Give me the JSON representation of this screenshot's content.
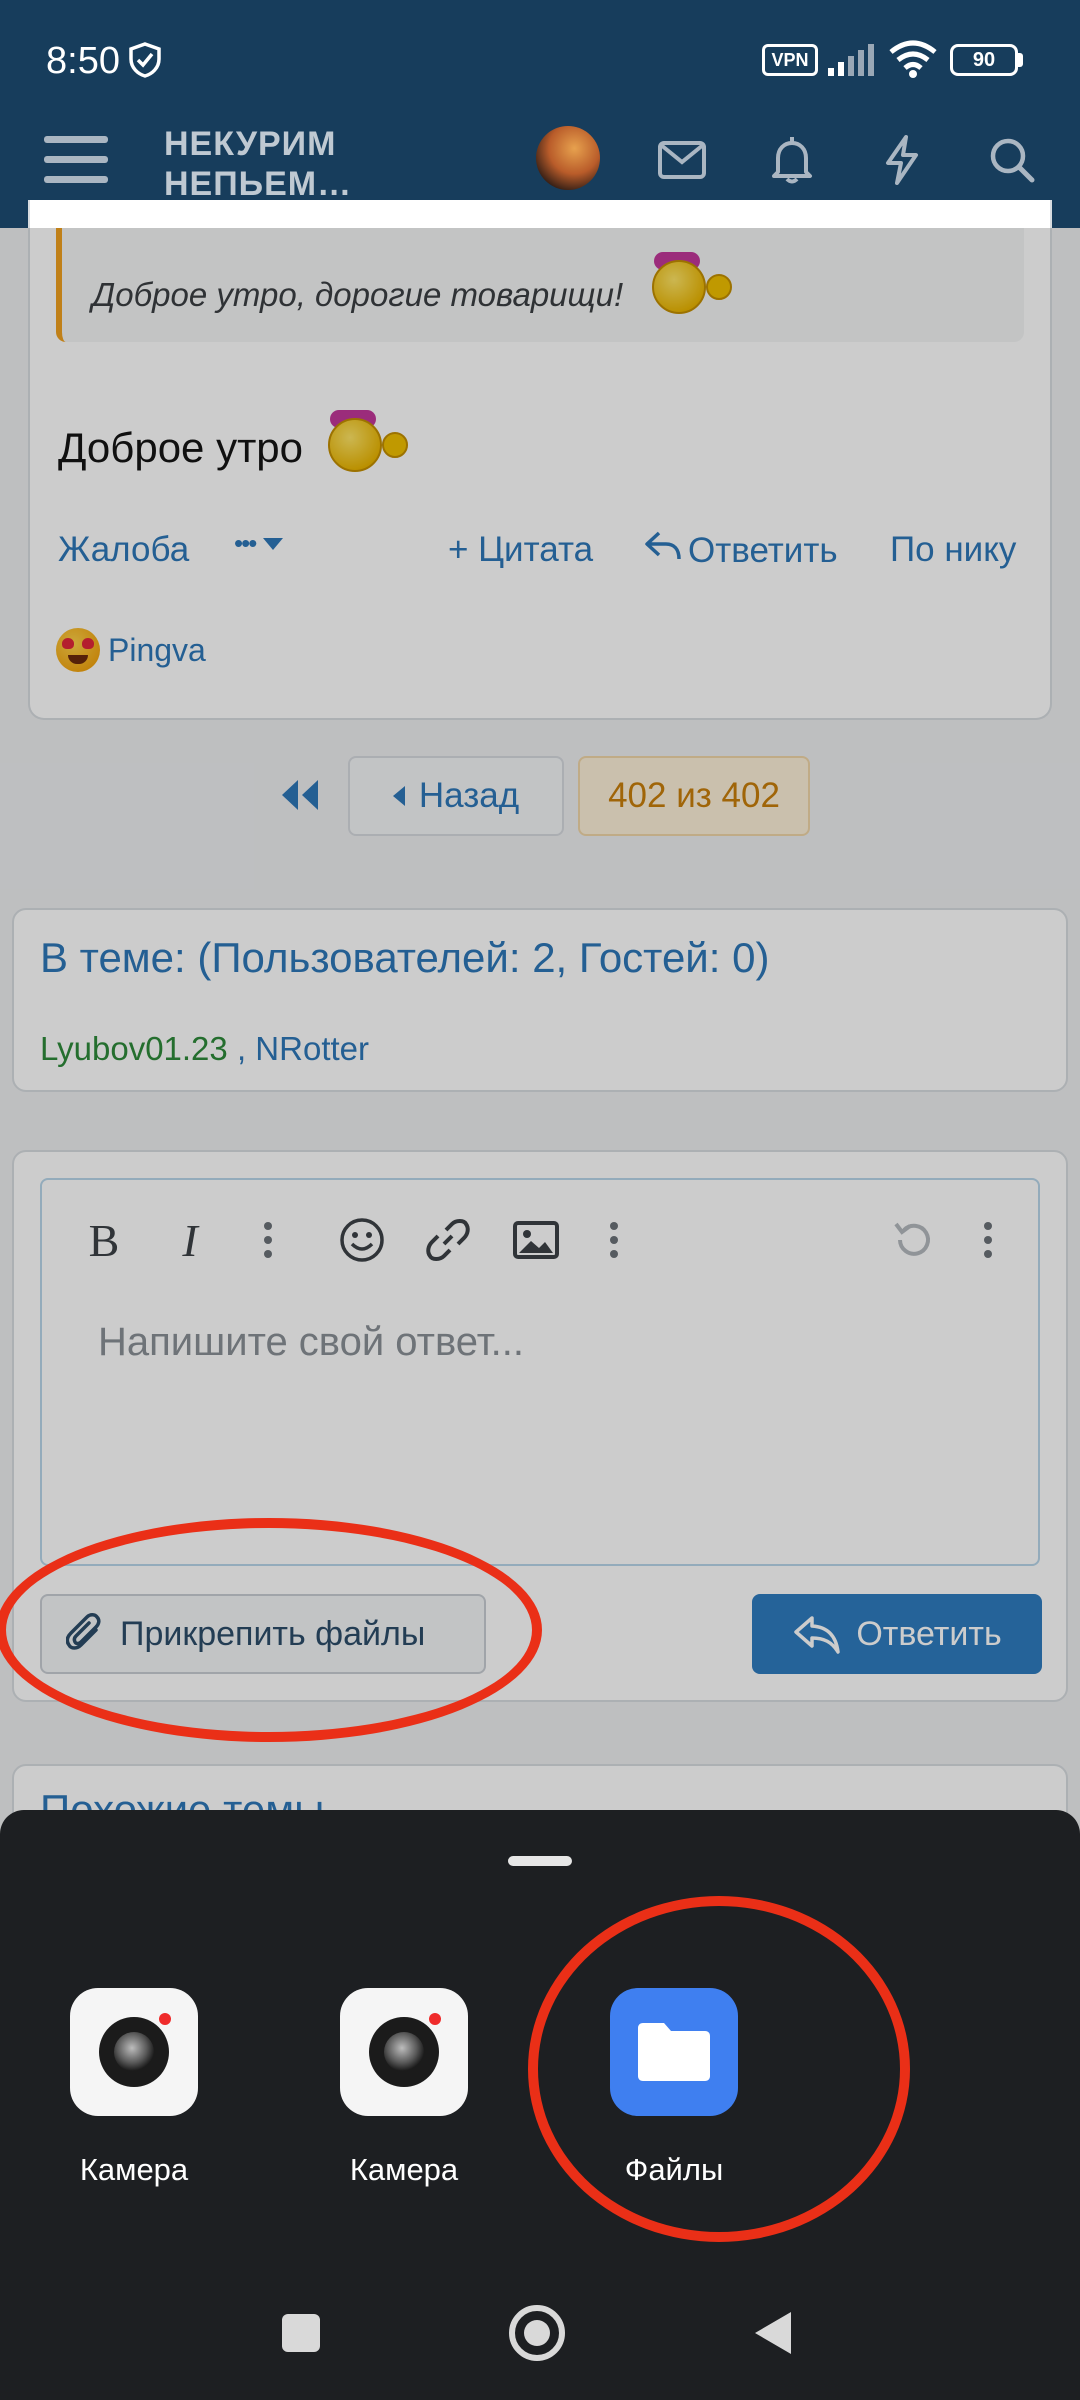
{
  "status_bar": {
    "time": "8:50",
    "vpn": "VPN",
    "battery": "90"
  },
  "header": {
    "logo_line1": "НЕКУРИМ",
    "logo_line2": "НЕПЬЕМ…"
  },
  "post": {
    "quote_text": "Доброе утро, дорогие товарищи!",
    "body_text": "Доброе утро",
    "actions": {
      "report": "Жалоба",
      "more": "•••",
      "quote": "+ Цитата",
      "reply": "Ответить",
      "by_nick": "По нику"
    },
    "reaction_user": "Pingva"
  },
  "pager": {
    "back": "Назад",
    "current": "402 из 402"
  },
  "online": {
    "title": "В теме: (Пользователей: 2, Гостей: 0)",
    "user1": "Lyubov01.23",
    "separator": " , ",
    "user2": "NRotter"
  },
  "editor": {
    "bold": "B",
    "italic": "I",
    "placeholder": "Напишите свой ответ...",
    "attach_label": "Прикрепить файлы",
    "reply_label": "Ответить"
  },
  "similar_threads_title": "Похожие темы",
  "sheet": {
    "apps": [
      {
        "label": "Камера",
        "icon": "camera-icon"
      },
      {
        "label": "Камера",
        "icon": "camera-icon"
      },
      {
        "label": "Файлы",
        "icon": "folder-icon"
      }
    ]
  },
  "colors": {
    "header": "#173d5c",
    "accent": "#2f7cc0",
    "highlight_ring": "#ea2f17",
    "sheet": "#1d1f22"
  }
}
